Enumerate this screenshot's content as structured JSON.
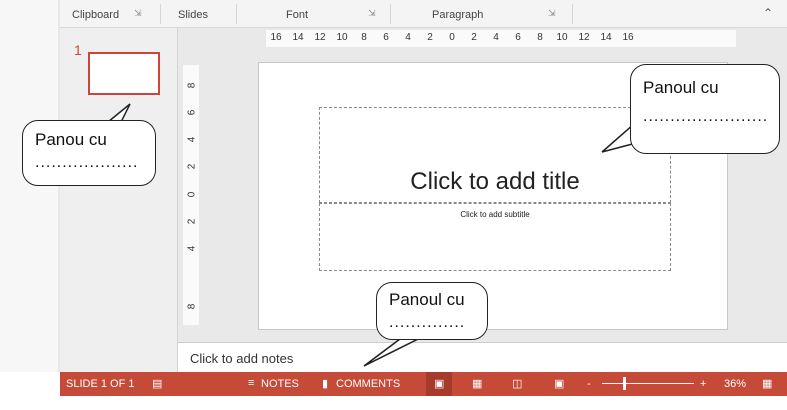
{
  "ribbon": {
    "groups": [
      "Clipboard",
      "Slides",
      "Font",
      "Paragraph"
    ]
  },
  "thumbnails": {
    "slide_number": "1"
  },
  "ruler": {
    "horizontal": [
      "16",
      "14",
      "12",
      "10",
      "8",
      "6",
      "4",
      "2",
      "0",
      "2",
      "4",
      "6",
      "8",
      "10",
      "12",
      "14",
      "16"
    ],
    "vertical": [
      "8",
      "6",
      "4",
      "2",
      "0",
      "2",
      "4",
      "8"
    ]
  },
  "slide": {
    "title_placeholder": "Click to add title",
    "subtitle_placeholder": "Click to add subtitle"
  },
  "notes": {
    "placeholder": "Click to add notes"
  },
  "status": {
    "slide_indicator": "SLIDE 1 OF 1",
    "notes_label": "NOTES",
    "comments_label": "COMMENTS",
    "zoom_minus": "-",
    "zoom_plus": "+",
    "zoom_level": "36%"
  },
  "callouts": {
    "left": {
      "label": "Panou cu",
      "blank": "..................."
    },
    "right": {
      "label": "Panoul cu",
      "blank": "......................."
    },
    "bottom": {
      "label": "Panoul cu",
      "blank": ".............."
    }
  },
  "colors": {
    "status_bar": "#c64a38",
    "accent": "#d0433a"
  },
  "icons": [
    "dialog-launcher-icon",
    "spellcheck-icon",
    "notes-icon",
    "comments-icon",
    "normal-view-icon",
    "slide-sorter-icon",
    "reading-view-icon",
    "slideshow-icon",
    "fit-to-window-icon",
    "collapse-ribbon-icon"
  ]
}
